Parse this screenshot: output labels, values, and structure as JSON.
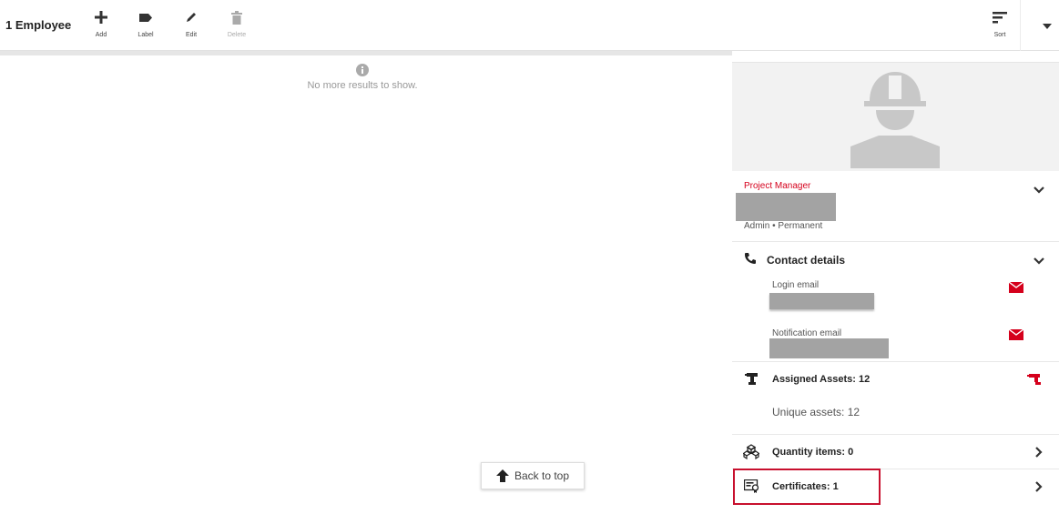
{
  "toolbar": {
    "count_title": "1 Employee",
    "actions": [
      {
        "label": "Add",
        "icon": "plus-icon",
        "enabled": true
      },
      {
        "label": "Label",
        "icon": "label-tag-icon",
        "enabled": true
      },
      {
        "label": "Edit",
        "icon": "pencil-icon",
        "enabled": true
      },
      {
        "label": "Delete",
        "icon": "trash-icon",
        "enabled": false
      }
    ],
    "sort_label": "Sort"
  },
  "list": {
    "empty_message": "No more results to show.",
    "back_to_top": "Back to top"
  },
  "detail": {
    "role_title": "Project Manager",
    "meta": "Admin • Permanent",
    "contact": {
      "title": "Contact details",
      "login_email_label": "Login email",
      "notification_email_label": "Notification email"
    },
    "assets": {
      "title": "Assigned Assets: 12",
      "unique": "Unique assets: 12"
    },
    "quantity_items": "Quantity items: 0",
    "certificates": "Certificates: 1"
  },
  "colors": {
    "accent": "#d5001c",
    "highlight_border": "#c8102e",
    "redaction": "#a3a3a3"
  }
}
